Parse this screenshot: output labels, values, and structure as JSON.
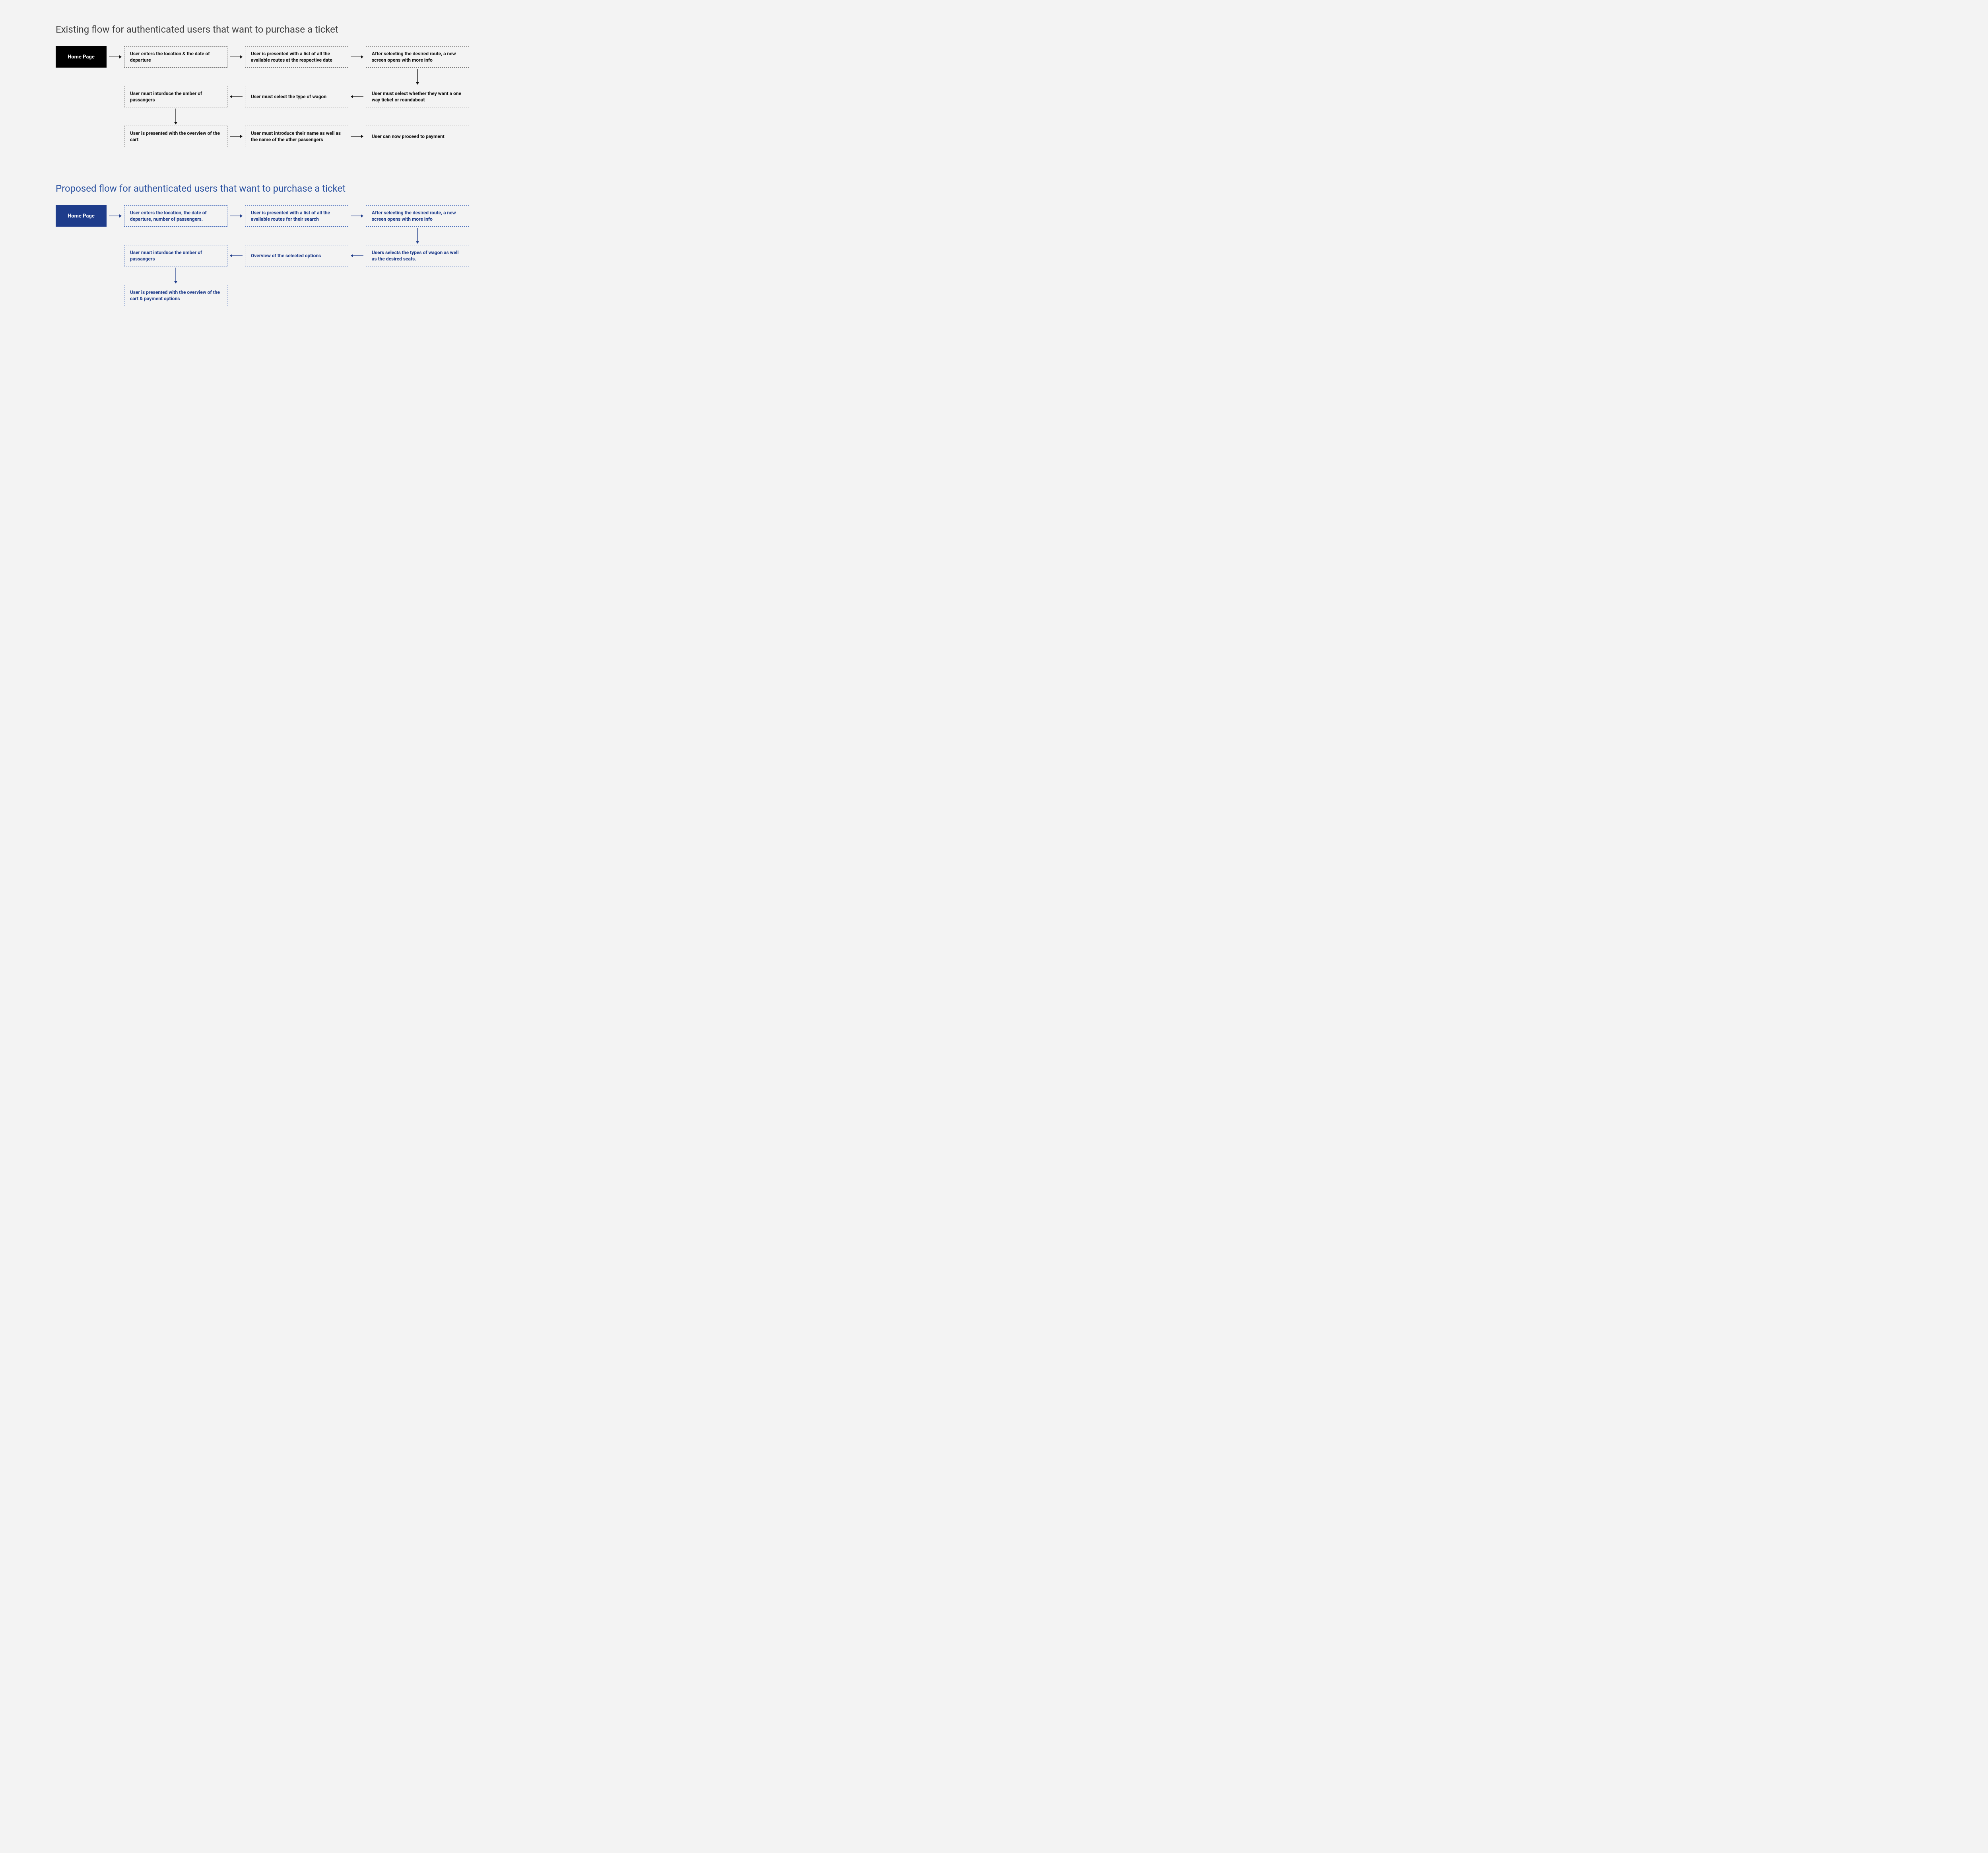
{
  "existing": {
    "title": "Existing flow for authenticated users that want to purchase a ticket",
    "home": "Home Page",
    "s1": "User enters the location & the date of departure",
    "s2": "User is presented with a list of all the available routes at the respective date",
    "s3": "After selecting the desired route, a new screen opens with more info",
    "s4": "User must select whether they want a one way ticket or roundabout",
    "s5": "User must select the type of wagon",
    "s6": "User must intorduce the umber of passangers",
    "s7": "User is presented with the overview of the cart",
    "s8": "User must introduce their name as well as the name of the other passengers",
    "s9": "User can now proceed to payment"
  },
  "proposed": {
    "title": "Proposed flow for authenticated users that want to purchase a ticket",
    "home": "Home Page",
    "s1": "User enters the location, the date of departure, number of passengers.",
    "s2": "User is presented with a list of all the available routes for their search",
    "s3": "After selecting the desired route, a new screen opens with more info",
    "s4": "Users selects the types of wagon as well as the desired seats.",
    "s5": "Overview of the selected options",
    "s6": "User must intorduce the umber of passangers",
    "s7": "User is presented with the overview of the cart & payment options"
  }
}
